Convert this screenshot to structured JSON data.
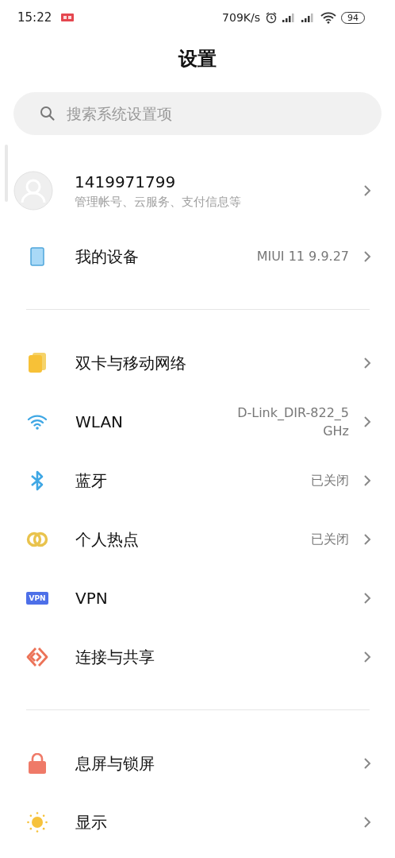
{
  "status_bar": {
    "time": "15:22",
    "net_speed": "709K/s",
    "battery": "94"
  },
  "title": "设置",
  "search": {
    "placeholder": "搜索系统设置项"
  },
  "account": {
    "name": "1419971799",
    "subtitle": "管理帐号、云服务、支付信息等"
  },
  "sections": [
    {
      "items": [
        {
          "label": "我的设备",
          "value": "MIUI 11 9.9.27"
        }
      ]
    },
    {
      "items": [
        {
          "label": "双卡与移动网络"
        },
        {
          "label": "WLAN",
          "value": "D-Link_DIR-822_5 GHz"
        },
        {
          "label": "蓝牙",
          "value": "已关闭"
        },
        {
          "label": "个人热点",
          "value": "已关闭"
        },
        {
          "label": "VPN",
          "icon_text": "VPN"
        },
        {
          "label": "连接与共享"
        }
      ]
    },
    {
      "items": [
        {
          "label": "息屏与锁屏"
        },
        {
          "label": "显示"
        }
      ]
    }
  ]
}
